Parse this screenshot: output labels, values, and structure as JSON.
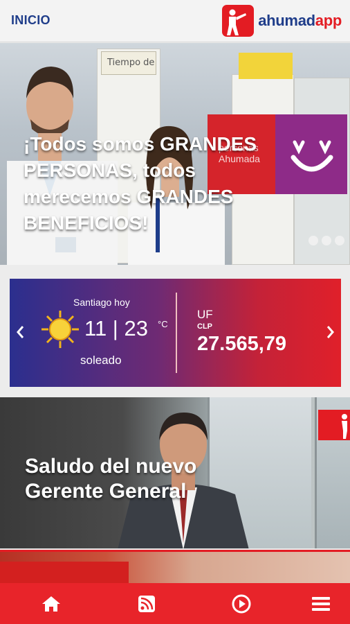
{
  "header": {
    "title": "INICIO",
    "logo_part1": "ahumad",
    "logo_part2": "app"
  },
  "hero": {
    "headline": "¡Todos somos GRANDES PERSONAS, todos merecemos GRANDES BENEFICIOS!",
    "sign_text": "Tiempo de",
    "ad_text": "personas Ahumada",
    "slides": 3
  },
  "weather": {
    "city": "Santiago hoy",
    "temperature": "11 | 23",
    "unit": "°C",
    "condition": "soleado",
    "icon": "sun-icon"
  },
  "currency": {
    "label": "UF",
    "sub_label": "CLP",
    "value": "27.565,79"
  },
  "video": {
    "caption": "Saludo del nuevo Gerente General"
  },
  "bottom_nav": [
    {
      "icon": "home-icon"
    },
    {
      "icon": "rss-icon"
    },
    {
      "icon": "play-icon"
    },
    {
      "icon": "menu-icon"
    }
  ],
  "colors": {
    "brand_red": "#e31c23",
    "brand_blue": "#1f3d8a",
    "weather_gradient_start": "#2b2f8e",
    "weather_gradient_end": "#e0202a"
  }
}
